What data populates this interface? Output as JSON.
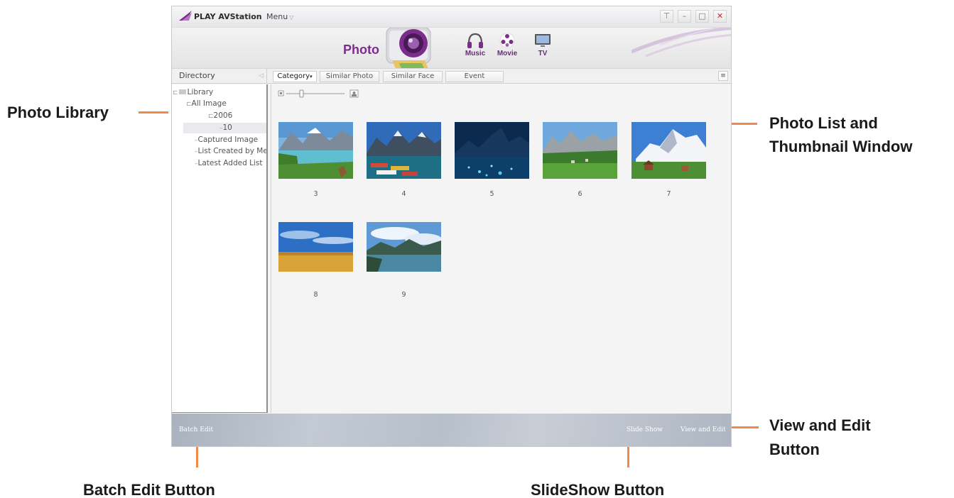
{
  "app": {
    "title": "PLAY AVStation",
    "menu_label": "Menu"
  },
  "media_tabs": {
    "photo": "Photo",
    "music": "Music",
    "movie": "Movie",
    "tv": "TV"
  },
  "toolbar": {
    "directory_label": "Directory",
    "tabs": [
      "Category",
      "Similar Photo",
      "Similar Face",
      "Event"
    ]
  },
  "tree": {
    "library": "Library",
    "all_image": "All Image",
    "year": "2006",
    "month": "10",
    "captured_image": "Captured Image",
    "list_created": "List Created by Me",
    "latest_added": "Latest Added List"
  },
  "thumbnails": [
    {
      "number": "3",
      "scene": "lake-with-deer"
    },
    {
      "number": "4",
      "scene": "mountain-lake-boats"
    },
    {
      "number": "5",
      "scene": "night-lake-lights"
    },
    {
      "number": "6",
      "scene": "alpine-meadow"
    },
    {
      "number": "7",
      "scene": "snowy-peak-village"
    },
    {
      "number": "8",
      "scene": "wheat-field-sky"
    },
    {
      "number": "9",
      "scene": "cloudy-lake"
    }
  ],
  "bottom_bar": {
    "batch_edit": "Batch Edit",
    "slide_show": "Slide Show",
    "view_and_edit": "View and Edit"
  },
  "callouts": {
    "photo_library": "Photo Library",
    "photo_list_line1": "Photo List and",
    "photo_list_line2": "Thumbnail Window",
    "view_edit_line1": "View and Edit",
    "view_edit_line2": "Button",
    "batch_edit": "Batch Edit Button",
    "slideshow": "SlideShow Button"
  },
  "colors": {
    "callout_line": "#f08a4b",
    "accent_purple": "#7a2d8a",
    "close_red": "#c0272d"
  }
}
